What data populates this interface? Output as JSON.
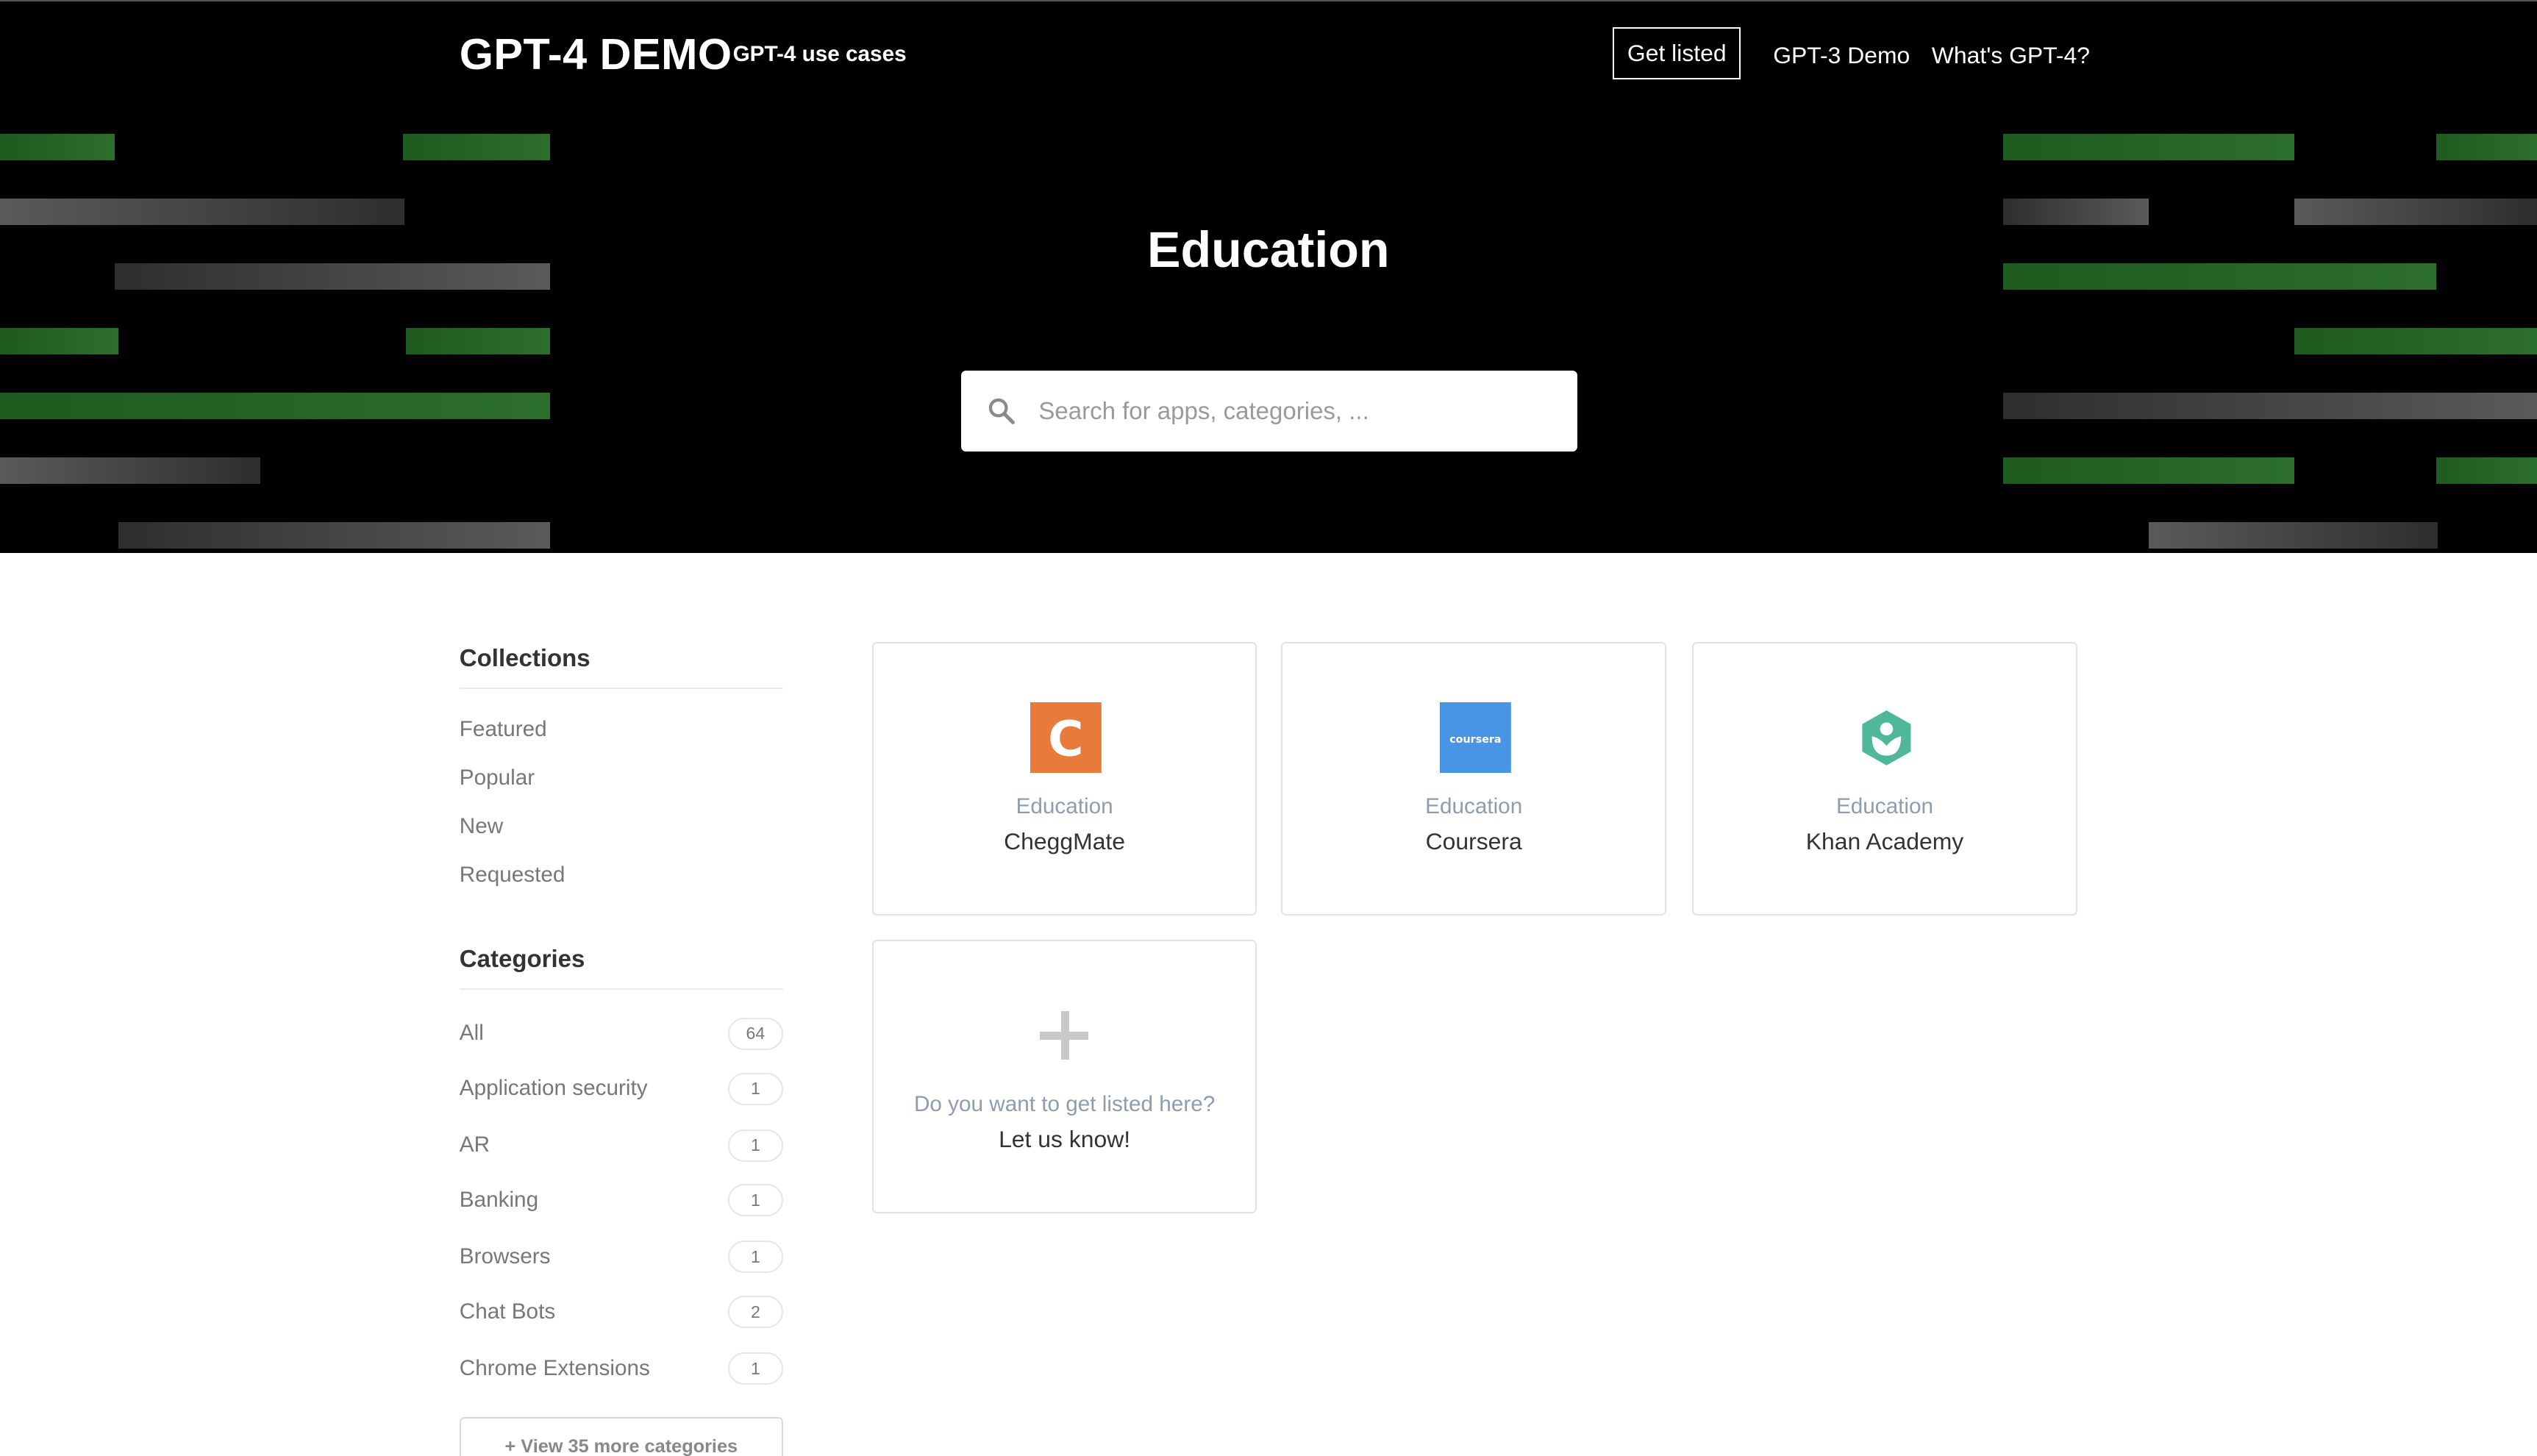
{
  "header": {
    "brand": "GPT-4 DEMO",
    "tagline": "GPT-4 use cases",
    "nav": {
      "get_listed": "Get listed",
      "gpt3_demo": "GPT-3 Demo",
      "whats_gpt4": "What's GPT-4?"
    }
  },
  "hero": {
    "title": "Education",
    "search_placeholder": "Search for apps, categories, ..."
  },
  "sidebar": {
    "collections_heading": "Collections",
    "collections": [
      "Featured",
      "Popular",
      "New",
      "Requested"
    ],
    "categories_heading": "Categories",
    "categories": [
      {
        "label": "All",
        "count": "64"
      },
      {
        "label": "Application security",
        "count": "1"
      },
      {
        "label": "AR",
        "count": "1"
      },
      {
        "label": "Banking",
        "count": "1"
      },
      {
        "label": "Browsers",
        "count": "1"
      },
      {
        "label": "Chat Bots",
        "count": "2"
      },
      {
        "label": "Chrome Extensions",
        "count": "1"
      }
    ],
    "more_button": "+ View 35 more categories"
  },
  "cards": [
    {
      "category": "Education",
      "name": "CheggMate",
      "logo": "cheggmate-logo",
      "logo_letter": "C",
      "color": "#e87a3c"
    },
    {
      "category": "Education",
      "name": "Coursera",
      "logo": "coursera-logo",
      "logo_text": "coursera",
      "color": "#4a94e6"
    },
    {
      "category": "Education",
      "name": "Khan Academy",
      "logo": "khan-academy-logo",
      "color": "#4fb79a"
    }
  ],
  "cta_card": {
    "question": "Do you want to get listed here?",
    "action": "Let us know!",
    "icon": "plus-icon"
  },
  "colors": {
    "hero_background": "#000000",
    "stripe_green": "#2c6e2c",
    "card_category": "#8e9cae"
  }
}
